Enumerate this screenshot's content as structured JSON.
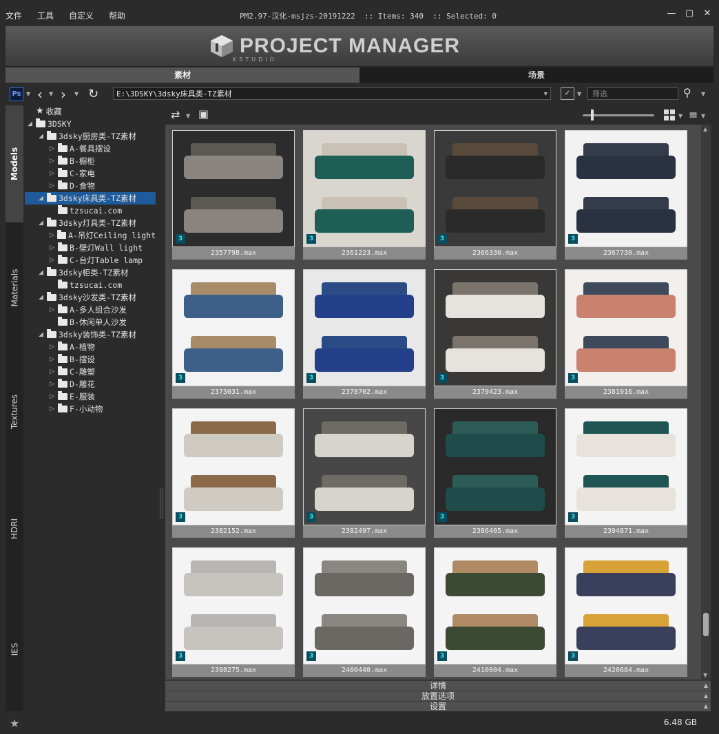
{
  "menu": [
    "文件",
    "工具",
    "自定义",
    "帮助"
  ],
  "window_title": "PM2.97-汉化-msjzs-20191222  :: Items: 340  :: Selected: 0",
  "window_buttons": [
    "minimize-icon",
    "maximize-icon",
    "close-icon"
  ],
  "logo": {
    "text": "PROJECT MANAGER",
    "subtext": "KSTUDIO"
  },
  "tabs": {
    "assets": "素材",
    "scenes": "场景"
  },
  "toolbar": {
    "photoshop_label": "Ps",
    "path": "E:\\3DSKY\\3dsky床具类-TZ素材",
    "filter_placeholder": "筛选"
  },
  "side_tabs": [
    "Models",
    "Materials",
    "Textures",
    "HDRI",
    "IES"
  ],
  "tree": [
    {
      "label": "收藏",
      "depth": 0,
      "arrow": "",
      "icon": "star"
    },
    {
      "label": "3DSKY",
      "depth": 0,
      "arrow": "open",
      "icon": "folder"
    },
    {
      "label": "3dsky厨房类-TZ素材",
      "depth": 1,
      "arrow": "open",
      "icon": "folder"
    },
    {
      "label": "A-餐具摆设",
      "depth": 2,
      "arrow": "closed",
      "icon": "folder"
    },
    {
      "label": "B-橱柜",
      "depth": 2,
      "arrow": "closed",
      "icon": "folder"
    },
    {
      "label": "C-家电",
      "depth": 2,
      "arrow": "closed",
      "icon": "folder"
    },
    {
      "label": "D-食物",
      "depth": 2,
      "arrow": "closed",
      "icon": "folder"
    },
    {
      "label": "3dsky床具类-TZ素材",
      "depth": 1,
      "arrow": "open",
      "icon": "folder",
      "selected": true
    },
    {
      "label": "tzsucai.com",
      "depth": 2,
      "arrow": "",
      "icon": "folder"
    },
    {
      "label": "3dsky灯具类-TZ素材",
      "depth": 1,
      "arrow": "open",
      "icon": "folder"
    },
    {
      "label": "A-吊灯Ceiling light",
      "depth": 2,
      "arrow": "closed",
      "icon": "folder"
    },
    {
      "label": "B-壁灯Wall light",
      "depth": 2,
      "arrow": "closed",
      "icon": "folder"
    },
    {
      "label": "C-台灯Table lamp",
      "depth": 2,
      "arrow": "closed",
      "icon": "folder"
    },
    {
      "label": "3dsky柜类-TZ素材",
      "depth": 1,
      "arrow": "open",
      "icon": "folder"
    },
    {
      "label": "tzsucai.com",
      "depth": 2,
      "arrow": "",
      "icon": "folder"
    },
    {
      "label": "3dsky沙发类-TZ素材",
      "depth": 1,
      "arrow": "open",
      "icon": "folder"
    },
    {
      "label": "A-多人组合沙发",
      "depth": 2,
      "arrow": "closed",
      "icon": "folder"
    },
    {
      "label": "B-休闲单人沙发",
      "depth": 2,
      "arrow": "",
      "icon": "folder"
    },
    {
      "label": "3dsky装饰类-TZ素材",
      "depth": 1,
      "arrow": "open",
      "icon": "folder"
    },
    {
      "label": "A-植物",
      "depth": 2,
      "arrow": "closed",
      "icon": "folder"
    },
    {
      "label": "B-摆设",
      "depth": 2,
      "arrow": "closed",
      "icon": "folder"
    },
    {
      "label": "C-雕塑",
      "depth": 2,
      "arrow": "closed",
      "icon": "folder"
    },
    {
      "label": "D-雕花",
      "depth": 2,
      "arrow": "closed",
      "icon": "folder"
    },
    {
      "label": "E-服装",
      "depth": 2,
      "arrow": "closed",
      "icon": "folder"
    },
    {
      "label": "F-小动物",
      "depth": 2,
      "arrow": "closed",
      "icon": "folder"
    }
  ],
  "assets": [
    {
      "name": "2357798.max",
      "bg": "#2c2c2c",
      "bed": "#8a8580",
      "head": "#5c5955"
    },
    {
      "name": "2361223.max",
      "bg": "#d9d6cf",
      "bed": "#1f5e55",
      "head": "#c9c2b4"
    },
    {
      "name": "2366330.max",
      "bg": "#3a3a3a",
      "bed": "#2a2a2a",
      "head": "#5a4a3c"
    },
    {
      "name": "2367730.max",
      "bg": "#f2f2f2",
      "bed": "#2a3140",
      "head": "#343b4a"
    },
    {
      "name": "2373031.max",
      "bg": "#f3f3f3",
      "bed": "#3d5f8a",
      "head": "#a88c68"
    },
    {
      "name": "2378702.max",
      "bg": "#e8e8e8",
      "bed": "#24408a",
      "head": "#2a4b86"
    },
    {
      "name": "2379423.max",
      "bg": "#3a3836",
      "bed": "#e6e3de",
      "head": "#7a746d"
    },
    {
      "name": "2381916.max",
      "bg": "#f2efed",
      "bed": "#c9826e",
      "head": "#3e4a5c"
    },
    {
      "name": "2382152.max",
      "bg": "#f4f4f4",
      "bed": "#cfcbc3",
      "head": "#8a6a48"
    },
    {
      "name": "2382497.max",
      "bg": "#474747",
      "bed": "#d7d3cd",
      "head": "#6e6a64"
    },
    {
      "name": "2386405.max",
      "bg": "#2a2a2a",
      "bed": "#1f4c4a",
      "head": "#2d5c58"
    },
    {
      "name": "2394871.max",
      "bg": "#f4f4f4",
      "bed": "#e7e2dc",
      "head": "#1e5552"
    },
    {
      "name": "2398275.max",
      "bg": "#f4f4f4",
      "bed": "#c7c4bf",
      "head": "#b8b6b2"
    },
    {
      "name": "2400440.max",
      "bg": "#f4f4f4",
      "bed": "#6b6864",
      "head": "#8a8782"
    },
    {
      "name": "2410004.max",
      "bg": "#f4f4f4",
      "bed": "#3c4a34",
      "head": "#b08a64"
    },
    {
      "name": "2420684.max",
      "bg": "#f4f4f4",
      "bed": "#3a3f5c",
      "head": "#d8a238"
    }
  ],
  "panels": [
    "详情",
    "放置选项",
    "设置"
  ],
  "status": {
    "size": "6.48 GB"
  }
}
